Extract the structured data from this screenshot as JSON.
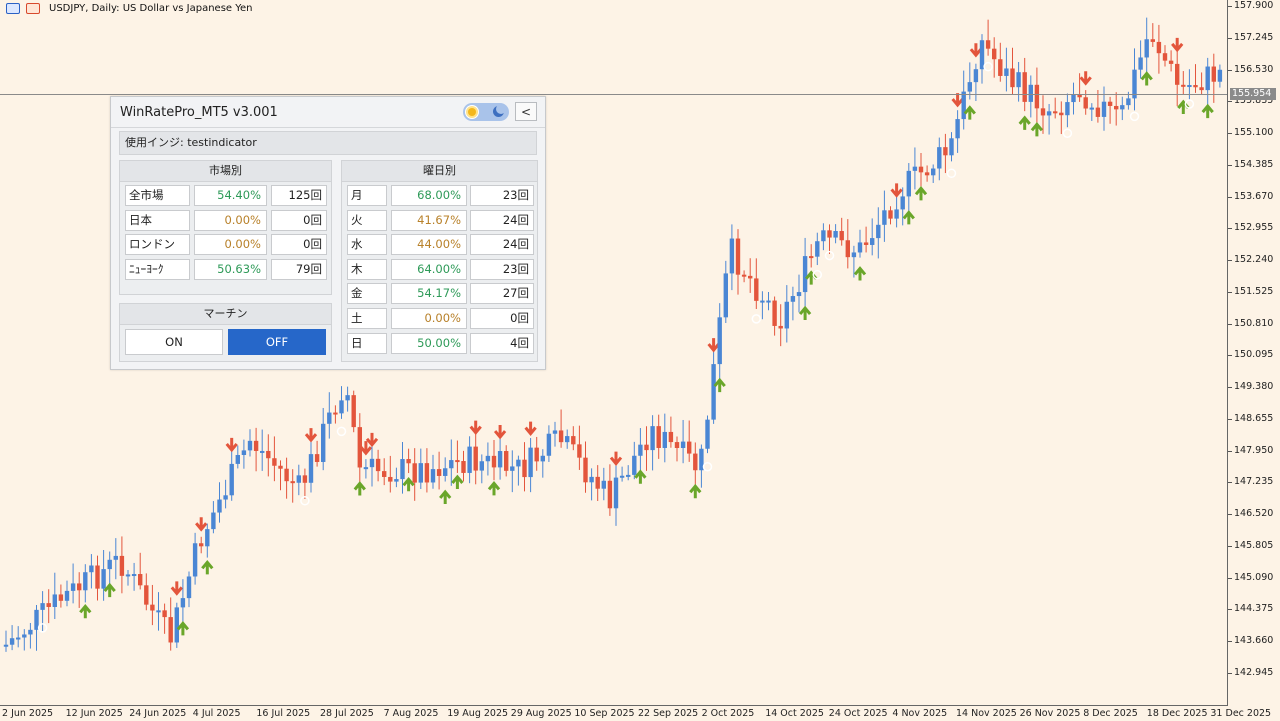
{
  "window": {
    "title": "USDJPY, Daily:  US Dollar vs Japanese Yen"
  },
  "colors": {
    "background": "#fdf3e6",
    "bull": "#4a86d4",
    "bear": "#e3553c",
    "buy_arrow": "#6aa62a",
    "sell_arrow": "#e3553c",
    "accent_button": "#2667c9",
    "good_pct": "#2e9a58",
    "neutral_pct": "#b8812a"
  },
  "price_axis": {
    "labels": [
      "157.900",
      "157.245",
      "156.530",
      "155.835",
      "155.100",
      "154.385",
      "153.670",
      "152.955",
      "152.240",
      "151.525",
      "150.810",
      "150.095",
      "149.380",
      "148.655",
      "147.950",
      "147.235",
      "146.520",
      "145.805",
      "145.090",
      "144.375",
      "143.660",
      "142.945"
    ],
    "current_price": "155.954"
  },
  "time_axis": {
    "labels": [
      "2 Jun 2025",
      "12 Jun 2025",
      "24 Jun 2025",
      "4 Jul 2025",
      "16 Jul 2025",
      "28 Jul 2025",
      "7 Aug 2025",
      "19 Aug 2025",
      "29 Aug 2025",
      "10 Sep 2025",
      "22 Sep 2025",
      "2 Oct 2025",
      "14 Oct 2025",
      "24 Oct 2025",
      "4 Nov 2025",
      "14 Nov 2025",
      "26 Nov 2025",
      "8 Dec 2025",
      "18 Dec 2025",
      "31 Dec 2025"
    ]
  },
  "chart_data": {
    "type": "candlestick",
    "symbol": "USDJPY",
    "timeframe": "Daily",
    "ylim": [
      142.6,
      158.2
    ],
    "note_arrows": "up arrows = buy signals, down arrows = sell signals",
    "candles": []
  },
  "panel": {
    "title": "WinRatePro_MT5 v3.001",
    "indicator_label": "使用インジ: testindicator",
    "market_section": {
      "header": "市場別",
      "rows": [
        {
          "label": "全市場",
          "pct": "54.40%",
          "count": "125回",
          "tone": "good"
        },
        {
          "label": "日本",
          "pct": "0.00%",
          "count": "0回",
          "tone": "neutral"
        },
        {
          "label": "ロンドン",
          "pct": "0.00%",
          "count": "0回",
          "tone": "neutral"
        },
        {
          "label": "ﾆｭｰﾖｰｸ",
          "pct": "50.63%",
          "count": "79回",
          "tone": "good"
        }
      ]
    },
    "weekday_section": {
      "header": "曜日別",
      "rows": [
        {
          "label": "月",
          "pct": "68.00%",
          "count": "23回",
          "tone": "good"
        },
        {
          "label": "火",
          "pct": "41.67%",
          "count": "24回",
          "tone": "neutral"
        },
        {
          "label": "水",
          "pct": "44.00%",
          "count": "24回",
          "tone": "neutral"
        },
        {
          "label": "木",
          "pct": "64.00%",
          "count": "23回",
          "tone": "good"
        },
        {
          "label": "金",
          "pct": "54.17%",
          "count": "27回",
          "tone": "good"
        },
        {
          "label": "土",
          "pct": "0.00%",
          "count": "0回",
          "tone": "neutral"
        },
        {
          "label": "日",
          "pct": "50.00%",
          "count": "4回",
          "tone": "good"
        }
      ]
    },
    "martin_section": {
      "header": "マーチン",
      "on_label": "ON",
      "off_label": "OFF",
      "selected": "OFF"
    },
    "collapse_label": "<"
  }
}
